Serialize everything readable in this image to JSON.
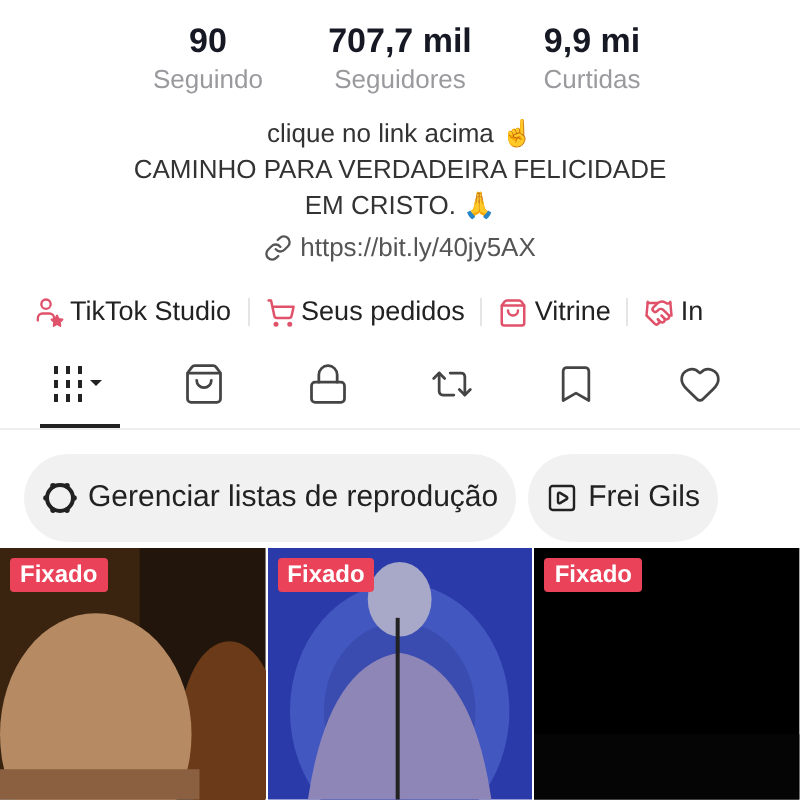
{
  "stats": [
    {
      "value": "90",
      "label": "Seguindo"
    },
    {
      "value": "707,7 mil",
      "label": "Seguidores"
    },
    {
      "value": "9,9 mi",
      "label": "Curtidas"
    }
  ],
  "bio": [
    "clique no link acima ☝",
    "CAMINHO PARA VERDADEIRA FELICIDADE",
    "EM CRISTO. 🙏"
  ],
  "link": "https://bit.ly/40jy5AX",
  "shortcuts": [
    {
      "kind": "studio",
      "label": "TikTok Studio"
    },
    {
      "kind": "orders",
      "label": "Seus pedidos"
    },
    {
      "kind": "showcase",
      "label": "Vitrine"
    },
    {
      "kind": "deals",
      "label": "In"
    }
  ],
  "tabs": [
    {
      "kind": "videos",
      "selected": true
    },
    {
      "kind": "shop",
      "selected": false
    },
    {
      "kind": "private",
      "selected": false
    },
    {
      "kind": "reposts",
      "selected": false
    },
    {
      "kind": "saved",
      "selected": false
    },
    {
      "kind": "liked",
      "selected": false
    }
  ],
  "chips": [
    {
      "kind": "manage",
      "label": "Gerenciar listas de reprodução"
    },
    {
      "kind": "playlist",
      "label": "Frei Gils"
    }
  ],
  "videos": [
    {
      "kind": "picture",
      "badge": "Fixado"
    },
    {
      "kind": "picture",
      "badge": "Fixado"
    },
    {
      "kind": "picture",
      "badge": "Fixado"
    }
  ]
}
